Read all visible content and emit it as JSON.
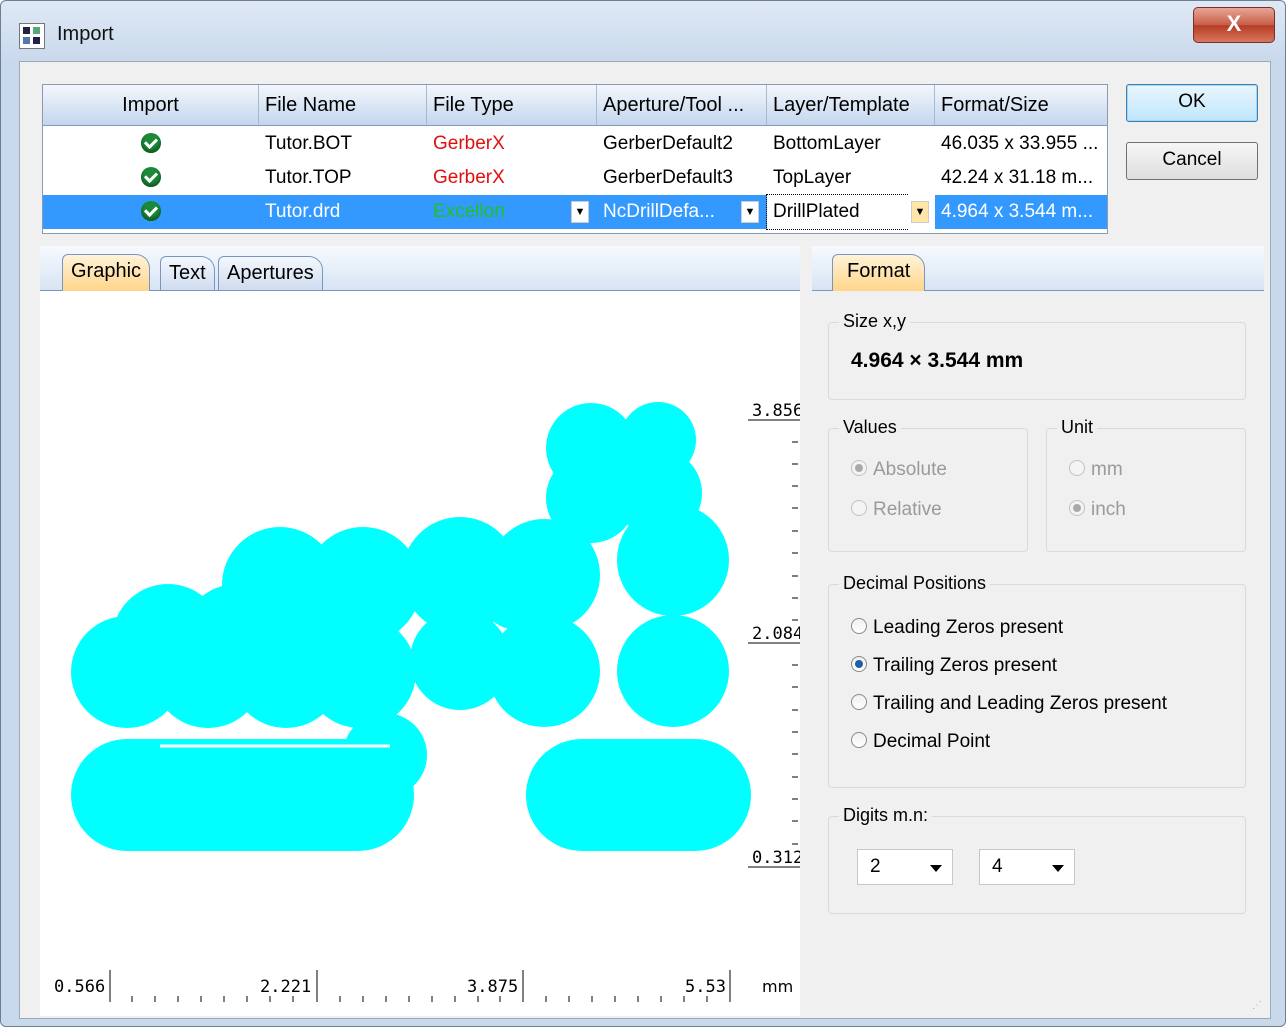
{
  "window": {
    "title": "Import",
    "close_label": "X"
  },
  "filelist": {
    "columns": [
      "Import",
      "File Name",
      "File Type",
      "Aperture/Tool ...",
      "Layer/Template",
      "Format/Size"
    ],
    "rows": [
      {
        "file": "Tutor.BOT",
        "type": "GerberX",
        "aperture": "GerberDefault2",
        "layer": "BottomLayer",
        "size": "46.035 x 33.955 ...",
        "selected": false
      },
      {
        "file": "Tutor.TOP",
        "type": "GerberX",
        "aperture": "GerberDefault3",
        "layer": "TopLayer",
        "size": "42.24 x 31.18 m...",
        "selected": false
      },
      {
        "file": "Tutor.drd",
        "type": "Excellon",
        "aperture": "NcDrillDefa...",
        "layer": "DrillPlated",
        "size": "4.964 x 3.544 m...",
        "selected": true
      }
    ]
  },
  "buttons": {
    "ok": "OK",
    "cancel": "Cancel"
  },
  "left_tabs": [
    "Graphic",
    "Text",
    "Apertures"
  ],
  "graphic": {
    "y_ticks": [
      "3.856",
      "2.084",
      "0.312"
    ],
    "x_ticks": [
      "0.566",
      "2.221",
      "3.875",
      "5.53"
    ],
    "unit": "mm",
    "drill_color": "#00ffff"
  },
  "right_tab": "Format",
  "format": {
    "size_label": "Size x,y",
    "size_value": "4.964 x 3.544 mm",
    "values_label": "Values",
    "values_options": [
      "Absolute",
      "Relative"
    ],
    "values_selected": "Absolute",
    "unit_label": "Unit",
    "unit_options": [
      "mm",
      "inch"
    ],
    "unit_selected": "inch",
    "decimal_label": "Decimal Positions",
    "decimal_options": [
      "Leading Zeros present",
      "Trailing Zeros present",
      "Trailing and Leading Zeros present",
      "Decimal Point"
    ],
    "decimal_selected": "Trailing Zeros present",
    "digits_label": "Digits m.n:",
    "digits_m": "2",
    "digits_n": "4"
  },
  "colors": {
    "type_gerber": "#e01010",
    "type_excellon": "#1ec21e",
    "selection": "#3399ff"
  }
}
